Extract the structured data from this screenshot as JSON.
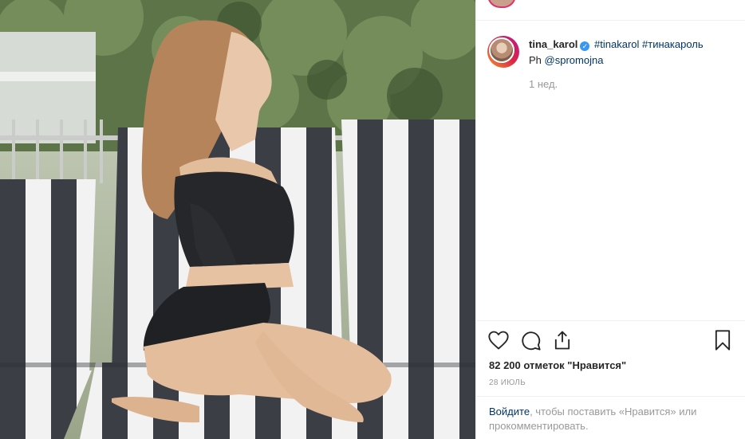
{
  "post": {
    "username": "tina_karol",
    "verified_badge": "verified-check-icon",
    "hashtags": [
      "#tinakarol",
      "#тинакароль"
    ],
    "photo_credit_prefix": "Ph",
    "photo_credit_mention": "@spromojna",
    "time_ago": "1 нед.",
    "likes": "82 200 отметок \"Нравится\"",
    "date": "28 ИЮЛЬ"
  },
  "actions": {
    "like_icon": "heart-icon",
    "comment_icon": "comment-icon",
    "share_icon": "share-icon",
    "save_icon": "bookmark-icon"
  },
  "login_prompt": {
    "link": "Войдите",
    "text": ", чтобы поставить «Нравится» или прокомментировать."
  },
  "colors": {
    "link": "#003569",
    "muted": "#999999",
    "verified": "#3897f0",
    "border": "#efefef"
  }
}
